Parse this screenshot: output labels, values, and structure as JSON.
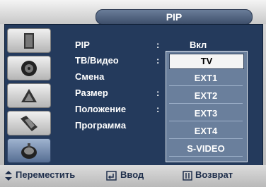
{
  "title": "PIP",
  "menu": [
    {
      "label": "PIP",
      "colon": ":",
      "value": "Вкл"
    },
    {
      "label": "ТВ/Видео",
      "colon": ":",
      "value": ""
    },
    {
      "label": "Смена",
      "colon": "",
      "value": ""
    },
    {
      "label": "Размер",
      "colon": ":",
      "value": ""
    },
    {
      "label": "Положение",
      "colon": ":",
      "value": ""
    },
    {
      "label": "Программа",
      "colon": "",
      "value": ""
    }
  ],
  "dropdown": {
    "options": [
      "TV",
      "EXT1",
      "EXT2",
      "EXT3",
      "EXT4",
      "S-VIDEO"
    ],
    "selected_index": 0
  },
  "sidebar": {
    "icons": [
      "picture-icon",
      "sound-icon",
      "channel-icon",
      "setup-icon",
      "input-icon"
    ],
    "active_index": 4
  },
  "footer": {
    "move": "Переместить",
    "enter": "Ввод",
    "back": "Возврат"
  }
}
